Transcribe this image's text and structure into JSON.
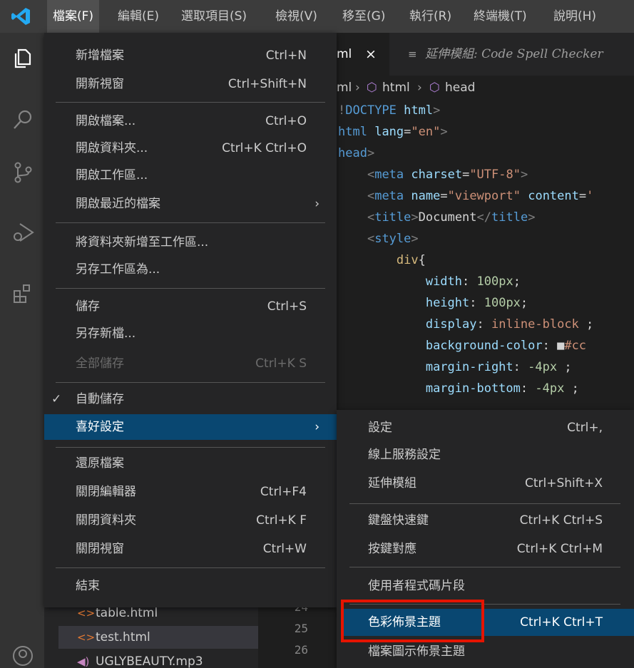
{
  "menubar": {
    "items": [
      "檔案(F)",
      "編輯(E)",
      "選取項目(S)",
      "檢視(V)",
      "移至(G)",
      "執行(R)",
      "終端機(T)",
      "說明(H)"
    ]
  },
  "editor": {
    "tab_active_label": "ml",
    "tab_active_close": "×",
    "tab_other_label": "延伸模組: Code Spell Checker",
    "breadcrumb": [
      "ml",
      "html",
      "head"
    ],
    "code_lines": [
      {
        "t": [
          [
            "punc",
            "!"
          ],
          [
            "tag",
            "DOCTYPE"
          ],
          [
            "txt",
            " "
          ],
          [
            "attr",
            "html"
          ],
          [
            "punc",
            ">"
          ]
        ]
      },
      {
        "t": [
          [
            "tag",
            "html"
          ],
          [
            "txt",
            " "
          ],
          [
            "attr",
            "lang"
          ],
          [
            "txt",
            "="
          ],
          [
            "str",
            "\"en\""
          ],
          [
            "punc",
            ">"
          ]
        ]
      },
      {
        "t": [
          [
            "tag",
            "head"
          ],
          [
            "punc",
            ">"
          ]
        ]
      },
      {
        "t": [
          [
            "txt",
            "    "
          ],
          [
            "punc",
            "<"
          ],
          [
            "tag",
            "meta"
          ],
          [
            "txt",
            " "
          ],
          [
            "attr",
            "charset"
          ],
          [
            "txt",
            "="
          ],
          [
            "str",
            "\"UTF-8\""
          ],
          [
            "punc",
            ">"
          ]
        ]
      },
      {
        "t": [
          [
            "txt",
            "    "
          ],
          [
            "punc",
            "<"
          ],
          [
            "tag",
            "meta"
          ],
          [
            "txt",
            " "
          ],
          [
            "attr",
            "name"
          ],
          [
            "txt",
            "="
          ],
          [
            "str",
            "\"viewport\""
          ],
          [
            "txt",
            " "
          ],
          [
            "attr",
            "content"
          ],
          [
            "txt",
            "="
          ],
          [
            "str",
            "'"
          ]
        ]
      },
      {
        "t": [
          [
            "txt",
            "    "
          ],
          [
            "punc",
            "<"
          ],
          [
            "tag",
            "title"
          ],
          [
            "punc",
            ">"
          ],
          [
            "txt",
            "Document"
          ],
          [
            "punc",
            "</"
          ],
          [
            "tag",
            "title"
          ],
          [
            "punc",
            ">"
          ]
        ]
      },
      {
        "t": [
          [
            "txt",
            "    "
          ],
          [
            "punc",
            "<"
          ],
          [
            "tag",
            "style"
          ],
          [
            "punc",
            ">"
          ]
        ]
      },
      {
        "t": [
          [
            "txt",
            "        "
          ],
          [
            "sel",
            "div"
          ],
          [
            "txt",
            "{"
          ]
        ]
      },
      {
        "t": [
          [
            "txt",
            "            "
          ],
          [
            "attr",
            "width"
          ],
          [
            "txt",
            ": "
          ],
          [
            "num",
            "100px"
          ],
          [
            "txt",
            ";"
          ]
        ]
      },
      {
        "t": [
          [
            "txt",
            "            "
          ],
          [
            "attr",
            "height"
          ],
          [
            "txt",
            ": "
          ],
          [
            "num",
            "100px"
          ],
          [
            "txt",
            ";"
          ]
        ]
      },
      {
        "t": [
          [
            "txt",
            "            "
          ],
          [
            "attr",
            "display"
          ],
          [
            "txt",
            ": "
          ],
          [
            "str",
            "inline-block"
          ],
          [
            "txt",
            " ;"
          ]
        ]
      },
      {
        "t": [
          [
            "txt",
            "            "
          ],
          [
            "attr",
            "background-color"
          ],
          [
            "txt",
            ": "
          ],
          [
            "txt",
            "■"
          ],
          [
            "str",
            "#cc"
          ]
        ]
      },
      {
        "t": [
          [
            "txt",
            "            "
          ],
          [
            "attr",
            "margin-right"
          ],
          [
            "txt",
            ": "
          ],
          [
            "num",
            "-4px"
          ],
          [
            "txt",
            " ;"
          ]
        ]
      },
      {
        "t": [
          [
            "txt",
            "            "
          ],
          [
            "attr",
            "margin-bottom"
          ],
          [
            "txt",
            ": "
          ],
          [
            "num",
            "-4px"
          ],
          [
            "txt",
            " ;"
          ]
        ]
      }
    ],
    "line_numbers": [
      "24",
      "25",
      "26"
    ]
  },
  "sidebar": {
    "files": [
      {
        "icon": "<>",
        "name": "table.html"
      },
      {
        "icon": "<>",
        "name": "test.html"
      },
      {
        "icon": "◀)",
        "name": "UGLYBEAUTY.mp3"
      }
    ]
  },
  "file_menu": {
    "items": [
      {
        "label": "新增檔案",
        "key": "Ctrl+N"
      },
      {
        "label": "開新視窗",
        "key": "Ctrl+Shift+N"
      },
      {
        "label": "開啟檔案...",
        "key": "Ctrl+O"
      },
      {
        "label": "開啟資料夾...",
        "key": "Ctrl+K Ctrl+O"
      },
      {
        "label": "開啟工作區...",
        "key": ""
      },
      {
        "label": "開啟最近的檔案",
        "key": "",
        "chevron": "›"
      },
      {
        "label": "將資料夾新增至工作區...",
        "key": ""
      },
      {
        "label": "另存工作區為...",
        "key": ""
      },
      {
        "label": "儲存",
        "key": "Ctrl+S"
      },
      {
        "label": "另存新檔...",
        "key": ""
      },
      {
        "label": "全部儲存",
        "key": "Ctrl+K S"
      },
      {
        "label": "自動儲存",
        "key": "",
        "check": "✓"
      },
      {
        "label": "喜好設定",
        "key": "",
        "chevron": "›"
      },
      {
        "label": "還原檔案",
        "key": ""
      },
      {
        "label": "關閉編輯器",
        "key": "Ctrl+F4"
      },
      {
        "label": "關閉資料夾",
        "key": "Ctrl+K F"
      },
      {
        "label": "關閉視窗",
        "key": "Ctrl+W"
      },
      {
        "label": "結束",
        "key": ""
      }
    ]
  },
  "preferences_submenu": {
    "items": [
      {
        "label": "設定",
        "key": "Ctrl+,"
      },
      {
        "label": "線上服務設定",
        "key": ""
      },
      {
        "label": "延伸模組",
        "key": "Ctrl+Shift+X"
      },
      {
        "label": "鍵盤快速鍵",
        "key": "Ctrl+K Ctrl+S"
      },
      {
        "label": "按鍵對應",
        "key": "Ctrl+K Ctrl+M"
      },
      {
        "label": "使用者程式碼片段",
        "key": ""
      },
      {
        "label": "色彩佈景主題",
        "key": "Ctrl+K Ctrl+T"
      },
      {
        "label": "檔案圖示佈景主題",
        "key": ""
      }
    ]
  }
}
